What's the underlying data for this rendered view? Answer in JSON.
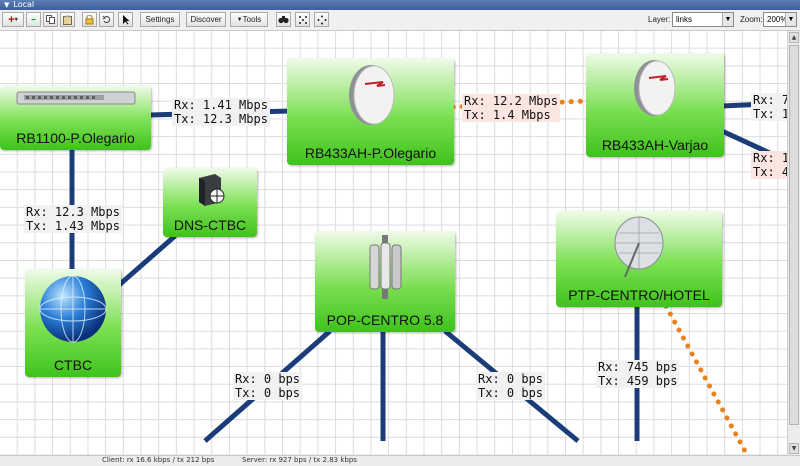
{
  "window": {
    "title": "Local"
  },
  "toolbar": {
    "settings": "Settings",
    "discover": "Discover",
    "tools": "Tools",
    "layer_label": "Layer:",
    "layer_value": "links",
    "zoom_label": "Zoom:",
    "zoom_value": "200%"
  },
  "nodes": [
    {
      "name": "RB1100-P.Olegario",
      "device": "router-rack-icon"
    },
    {
      "name": "RB433AH-P.Olegario",
      "device": "dish-antenna-icon"
    },
    {
      "name": "RB433AH-Varjao",
      "device": "dish-antenna-icon"
    },
    {
      "name": "DNS-CTBC",
      "device": "server-globe-icon"
    },
    {
      "name": "CTBC",
      "device": "globe-icon"
    },
    {
      "name": "POP-CENTRO 5.8",
      "device": "sector-antenna-icon"
    },
    {
      "name": "PTP-CENTRO/HOTEL",
      "device": "grid-dish-icon"
    }
  ],
  "links": [
    {
      "rx": "Rx: 1.41 Mbps",
      "tx": "Tx: 12.3 Mbps"
    },
    {
      "rx": "Rx: 12.2 Mbps",
      "tx": "Tx: 1.4 Mbps"
    },
    {
      "rx": "Rx: 7",
      "tx": "Tx: 1"
    },
    {
      "rx": "Rx: 1",
      "tx": "Tx: 4"
    },
    {
      "rx": "Rx: 12.3 Mbps",
      "tx": "Tx: 1.43 Mbps"
    },
    {
      "rx": "Rx: 0 bps",
      "tx": "Tx: 0 bps"
    },
    {
      "rx": "Rx: 0 bps",
      "tx": "Tx: 0 bps"
    },
    {
      "rx": "Rx: 745 bps",
      "tx": "Tx: 459 bps"
    }
  ],
  "status": {
    "client": "Client: rx 16.6 kbps / tx 212 bps",
    "server": "Server: rx 927 bps / tx 2.83 kbps"
  },
  "colors": {
    "link": "#1a3c78",
    "wireless": "#e8821f",
    "node": "#5fd23a"
  }
}
